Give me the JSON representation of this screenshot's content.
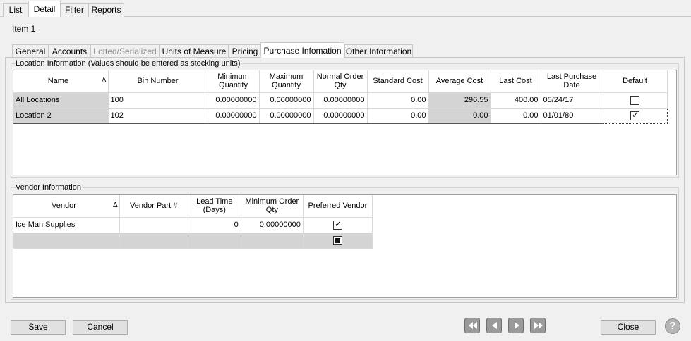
{
  "top_tabs": [
    "List",
    "Detail",
    "Filter",
    "Reports"
  ],
  "item_title": "Item 1",
  "sub_tabs": [
    "General",
    "Accounts",
    "Lotted/Serialized",
    "Units of Measure",
    "Pricing",
    "Purchase Infomation",
    "Other Information"
  ],
  "location_group_label": "Location Information (Values should be entered as stocking units)",
  "location_headers": [
    "Name",
    "Bin Number",
    "Minimum Quantity",
    "Maximum Quantity",
    "Normal Order Qty",
    "Standard Cost",
    "Average Cost",
    "Last Cost",
    "Last Purchase Date",
    "Default"
  ],
  "location_rows": [
    {
      "name": "All Locations",
      "bin": "100",
      "min": "0.00000000",
      "max": "0.00000000",
      "normal": "0.00000000",
      "std_cost": "0.00",
      "avg_cost": "296.55",
      "last_cost": "400.00",
      "last_date": "05/24/17",
      "default": false
    },
    {
      "name": "Location 2",
      "bin": "102",
      "min": "0.00000000",
      "max": "0.00000000",
      "normal": "0.00000000",
      "std_cost": "0.00",
      "avg_cost": "0.00",
      "last_cost": "0.00",
      "last_date": "01/01/80",
      "default": true
    }
  ],
  "vendor_group_label": "Vendor Information",
  "vendor_headers": [
    "Vendor",
    "Vendor Part #",
    "Lead Time (Days)",
    "Minimum Order Qty",
    "Preferred Vendor"
  ],
  "vendor_rows": [
    {
      "vendor": "Ice Man Supplies",
      "part": "",
      "lead": "0",
      "min_order": "0.00000000",
      "preferred": true
    }
  ],
  "sort_indicator": "Δ",
  "buttons": {
    "save": "Save",
    "cancel": "Cancel",
    "close": "Close",
    "help": "?"
  },
  "icons": {
    "first": "first-record-icon",
    "prev": "previous-record-icon",
    "next": "next-record-icon",
    "last": "last-record-icon"
  }
}
